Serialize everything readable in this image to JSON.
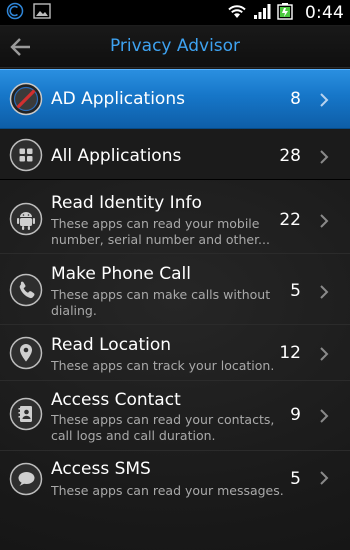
{
  "status_bar": {
    "time": "0:44",
    "icons": [
      "app-notification-icon",
      "gallery-notification-icon",
      "wifi-icon",
      "signal-icon",
      "battery-icon"
    ]
  },
  "header": {
    "title": "Privacy Advisor",
    "back_icon": "back-arrow-icon"
  },
  "ad_applications": {
    "label": "AD Applications",
    "count": "8",
    "icon": "blocked-icon"
  },
  "all_applications": {
    "label": "All Applications",
    "count": "28",
    "icon": "grid-icon"
  },
  "permissions": [
    {
      "label": "Read Identity Info",
      "desc_line1": "These apps can read your mobile",
      "desc_line2": "number, serial number and other...",
      "count": "22",
      "icon": "android-icon"
    },
    {
      "label": "Make Phone Call",
      "desc_line1": "These apps can make calls without",
      "desc_line2": "dialing.",
      "count": "5",
      "icon": "phone-icon"
    },
    {
      "label": "Read Location",
      "desc_line1": "These apps can track your location.",
      "desc_line2": "",
      "count": "12",
      "icon": "location-icon"
    },
    {
      "label": "Access Contact",
      "desc_line1": "These apps can read your contacts,",
      "desc_line2": "call logs and call duration.",
      "count": "9",
      "icon": "contacts-icon"
    },
    {
      "label": "Access SMS",
      "desc_line1": "These apps can read your messages.",
      "desc_line2": "",
      "count": "5",
      "icon": "sms-icon"
    }
  ],
  "colors": {
    "accent": "#3ea2f0",
    "highlight": "#1676c8",
    "background": "#1a1a1a",
    "secondary_text": "#a9a9a9"
  }
}
